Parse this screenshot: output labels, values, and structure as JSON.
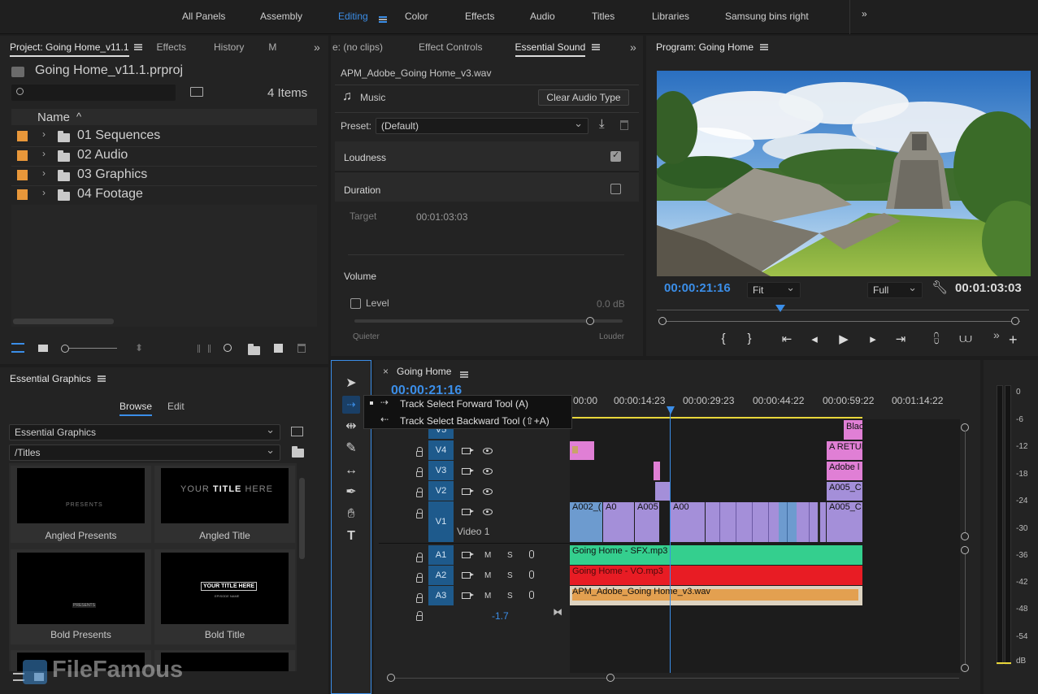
{
  "workspaces": {
    "items": [
      "All Panels",
      "Assembly",
      "Editing",
      "Color",
      "Effects",
      "Audio",
      "Titles",
      "Libraries",
      "Samsung bins right"
    ],
    "active": "Editing",
    "more": "»"
  },
  "project": {
    "tabs": [
      "Project: Going Home_v11.1",
      "Effects",
      "History",
      "M"
    ],
    "more": "»",
    "filename": "Going Home_v11.1.prproj",
    "item_count": "4 Items",
    "column_name": "Name",
    "bins": [
      "01 Sequences",
      "02 Audio",
      "03 Graphics",
      "04 Footage"
    ]
  },
  "essential_sound": {
    "tabs": [
      "e: (no clips)",
      "Effect Controls",
      "Essential Sound"
    ],
    "more": "»",
    "clip_name": "APM_Adobe_Going Home_v3.wav",
    "audio_type": "Music",
    "clear_button": "Clear Audio Type",
    "preset_label": "Preset:",
    "preset_value": "(Default)",
    "loudness_label": "Loudness",
    "loudness_checked": true,
    "duration_label": "Duration",
    "duration_checked": false,
    "target_label": "Target",
    "target_value": "00:01:03:03",
    "volume_label": "Volume",
    "level_label": "Level",
    "level_value": "0.0 dB",
    "quieter": "Quieter",
    "louder": "Louder",
    "level_slider": 0.88
  },
  "program": {
    "title": "Program: Going Home",
    "timecode": "00:00:21:16",
    "fit": "Fit",
    "quality": "Full",
    "duration": "00:01:03:03",
    "more": "»",
    "playhead_fraction": 0.34
  },
  "essential_graphics": {
    "title": "Essential Graphics",
    "browse": "Browse",
    "edit": "Edit",
    "library": "Essential Graphics",
    "folder": "/Titles",
    "templates": [
      {
        "name": "Angled Presents",
        "preview": "PRESENTS"
      },
      {
        "name": "Angled Title",
        "preview_a": "YOUR ",
        "preview_b": "TITLE",
        "preview_c": " HERE"
      },
      {
        "name": "Bold Presents",
        "preview": "PRESENTS"
      },
      {
        "name": "Bold Title",
        "preview": "YOUR TITLE HERE",
        "preview_sub": "EPISODE NAME"
      }
    ]
  },
  "tools": {
    "flyout": [
      {
        "label": "Track Select Forward Tool (A)"
      },
      {
        "label": "Track Select Backward Tool (⇧+A)"
      }
    ]
  },
  "timeline": {
    "sequence": "Going Home",
    "timecode": "00:00:21:16",
    "ruler": [
      "00:00",
      "00:00:14:23",
      "00:00:29:23",
      "00:00:44:22",
      "00:00:59:22",
      "00:01:14:22"
    ],
    "video_tracks": [
      "V5",
      "V4",
      "V3",
      "V2",
      "V1"
    ],
    "v1_name": "Video 1",
    "audio_tracks": [
      "A1",
      "A2",
      "A3"
    ],
    "m_label": "M",
    "s_label": "S",
    "master_value": "-1.7",
    "clips": {
      "v5": "Blac",
      "v4": "A RETUR",
      "v3": "Adobe l",
      "v2": "A005_C",
      "v1_a": "A002_(",
      "v1_b": "A0",
      "v1_c": "A005",
      "v1_d": "A00",
      "v1_e": "A005_C",
      "a1": "Going Home - SFX.mp3",
      "a2": "Going Home - VO.mp3",
      "a3": "APM_Adobe_Going Home_v3.wav"
    },
    "colors": {
      "track_blue": "#1e5a8c",
      "v1_lavender": "#a48fd9",
      "v1_blue": "#6d9bcf",
      "pink": "#e07fd5",
      "a1_green": "#34cf8e",
      "a2_red": "#e81c24",
      "a3_orange": "#e3a050",
      "playhead": "#3b8ee8"
    }
  },
  "meter": {
    "labels": [
      "0",
      "-6",
      "-12",
      "-18",
      "-24",
      "-30",
      "-36",
      "-42",
      "-48",
      "-54",
      "dB"
    ]
  },
  "watermark": "FileFamous"
}
